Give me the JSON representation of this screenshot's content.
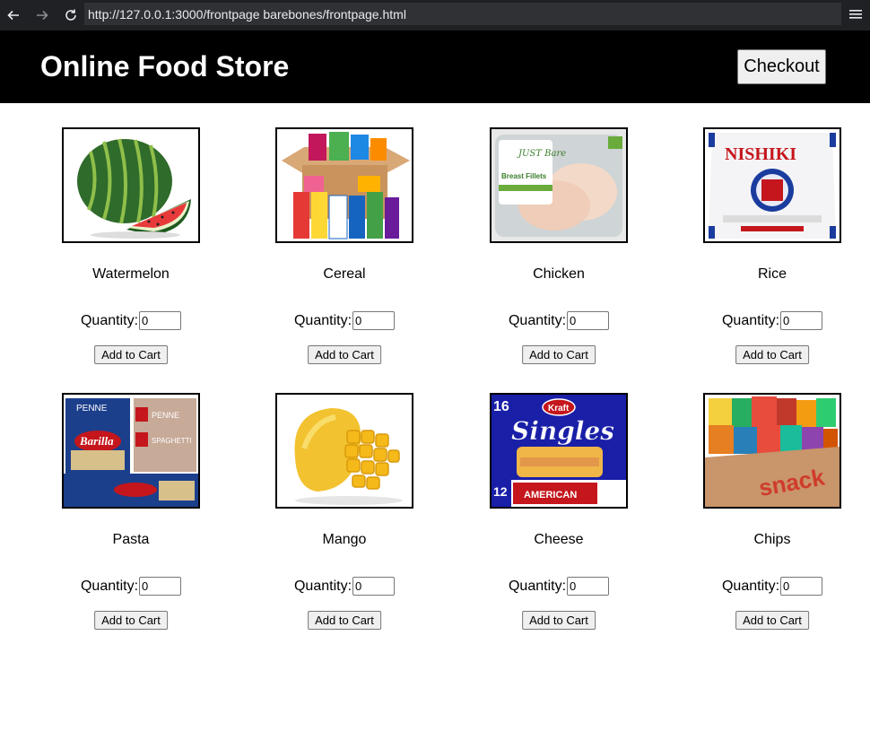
{
  "browser": {
    "url": "http://127.0.0.1:3000/frontpage barebones/frontpage.html",
    "back_icon": "arrow-left-icon",
    "forward_icon": "arrow-right-icon",
    "reload_icon": "reload-icon",
    "menu_icon": "hamburger-menu-icon"
  },
  "header": {
    "title": "Online Food Store",
    "checkout_label": "Checkout"
  },
  "products": [
    {
      "name": "Watermelon",
      "quantity_label": "Quantity:",
      "quantity_value": "0",
      "add_label": "Add to Cart",
      "image": "watermelon-image"
    },
    {
      "name": "Cereal",
      "quantity_label": "Quantity:",
      "quantity_value": "0",
      "add_label": "Add to Cart",
      "image": "cereal-box-image"
    },
    {
      "name": "Chicken",
      "quantity_label": "Quantity:",
      "quantity_value": "0",
      "add_label": "Add to Cart",
      "image": "chicken-package-image"
    },
    {
      "name": "Rice",
      "quantity_label": "Quantity:",
      "quantity_value": "0",
      "add_label": "Add to Cart",
      "image": "rice-bag-image"
    },
    {
      "name": "Pasta",
      "quantity_label": "Quantity:",
      "quantity_value": "0",
      "add_label": "Add to Cart",
      "image": "pasta-boxes-image"
    },
    {
      "name": "Mango",
      "quantity_label": "Quantity:",
      "quantity_value": "0",
      "add_label": "Add to Cart",
      "image": "mango-image"
    },
    {
      "name": "Cheese",
      "quantity_label": "Quantity:",
      "quantity_value": "0",
      "add_label": "Add to Cart",
      "image": "cheese-singles-image"
    },
    {
      "name": "Chips",
      "quantity_label": "Quantity:",
      "quantity_value": "0",
      "add_label": "Add to Cart",
      "image": "chips-box-image"
    }
  ],
  "product_images": {
    "chicken_brand": "JUST Bare",
    "chicken_label": "Breast Fillets",
    "rice_brand": "NISHIKI",
    "pasta_brand": "Barilla",
    "pasta_labels": [
      "PENNE",
      "SPAGHETTI"
    ],
    "cheese_brand": "Kraft",
    "cheese_label": "Singles",
    "cheese_variant": "AMERICAN",
    "chips_label": "snack"
  },
  "colors": {
    "header_bg": "#000000",
    "browser_bg": "#202124"
  }
}
